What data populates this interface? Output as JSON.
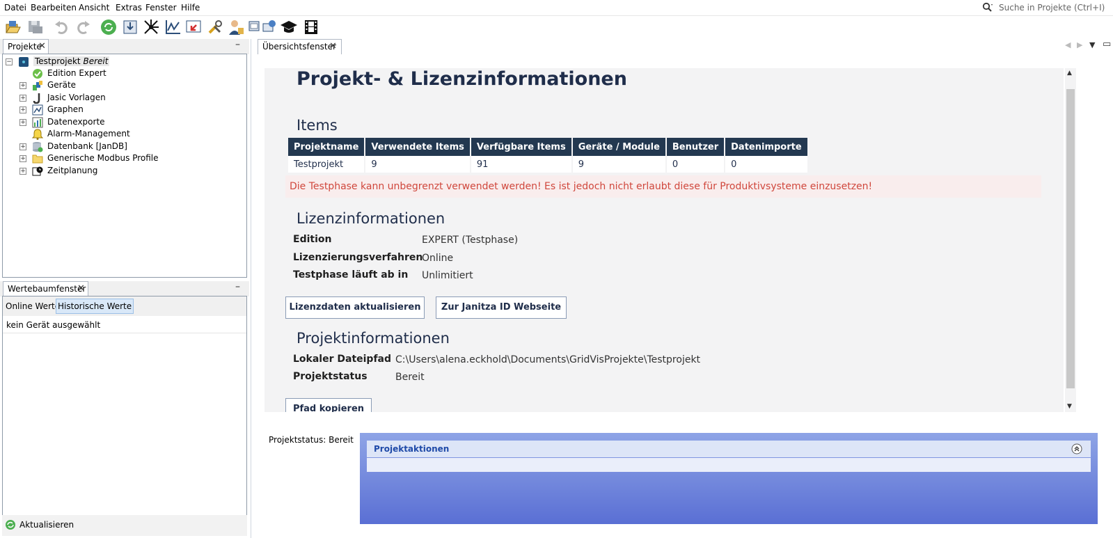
{
  "menu": [
    "Datei",
    "Bearbeiten",
    "Ansicht",
    "Extras",
    "Fenster",
    "Hilfe"
  ],
  "search": {
    "placeholder": "Suche in Projekte (Ctrl+I)"
  },
  "toolbar_icons": [
    "open-project-icon",
    "save-icon",
    "undo-icon",
    "redo-icon",
    "refresh-icon",
    "import-icon",
    "topology-icon",
    "graph-icon",
    "export-icon",
    "tools-icon",
    "user-icon",
    "device-window-icon",
    "academy-icon",
    "film-icon"
  ],
  "projects_panel": {
    "tab": "Projekte",
    "tree": [
      {
        "label": "Testprojekt",
        "status": "Bereit",
        "icon": "project-icon",
        "level": 0,
        "expandable": true
      },
      {
        "label": "Edition Expert",
        "icon": "check-circle-icon",
        "level": 1,
        "expandable": false
      },
      {
        "label": "Geräte",
        "icon": "devices-icon",
        "level": 1,
        "expandable": true
      },
      {
        "label": "Jasic Vorlagen",
        "icon": "jasic-icon",
        "level": 1,
        "expandable": true
      },
      {
        "label": "Graphen",
        "icon": "graph-icon",
        "level": 1,
        "expandable": true
      },
      {
        "label": "Datenexporte",
        "icon": "export-chart-icon",
        "level": 1,
        "expandable": true
      },
      {
        "label": "Alarm-Management",
        "icon": "bell-icon",
        "level": 1,
        "expandable": false
      },
      {
        "label": "Datenbank [JanDB]",
        "icon": "database-icon",
        "level": 1,
        "expandable": true
      },
      {
        "label": "Generische Modbus Profile",
        "icon": "folder-icon",
        "level": 1,
        "expandable": true
      },
      {
        "label": "Zeitplanung",
        "icon": "clock-icon",
        "level": 1,
        "expandable": true
      }
    ]
  },
  "value_tree_panel": {
    "tab": "Wertebaumfenster",
    "tabs": [
      "Online Werte",
      "Historische Werte"
    ],
    "selected_tab": "Historische Werte",
    "message": "kein Gerät ausgewählt",
    "refresh_label": "Aktualisieren"
  },
  "overview": {
    "tab": "Übersichtsfenster",
    "title": "Projekt- & Lizenzinformationen",
    "items_heading": "Items",
    "items_table": {
      "headers": [
        "Projektname",
        "Verwendete Items",
        "Verfügbare Items",
        "Geräte / Module",
        "Benutzer",
        "Datenimporte"
      ],
      "rows": [
        [
          "Testprojekt",
          "9",
          "91",
          "9",
          "0",
          "0"
        ]
      ]
    },
    "warning": "Die Testphase kann unbegrenzt verwendet werden! Es ist jedoch nicht erlaubt diese für Produktivsysteme einzusetzen!",
    "license_heading": "Lizenzinformationen",
    "license": [
      {
        "label": "Edition",
        "value": "EXPERT (Testphase)"
      },
      {
        "label": "Lizenzierungsverfahren",
        "value": "Online"
      },
      {
        "label": "Testphase läuft ab in",
        "value": "Unlimitiert"
      }
    ],
    "buttons": {
      "update_license": "Lizenzdaten aktualisieren",
      "janitza_id": "Zur Janitza ID Webseite",
      "copy_path": "Pfad kopieren"
    },
    "project_heading": "Projektinformationen",
    "project": [
      {
        "label": "Lokaler Dateipfad",
        "value": "C:\\Users\\alena.eckhold\\Documents\\GridVisProjekte\\Testprojekt"
      },
      {
        "label": "Projektstatus",
        "value": "Bereit"
      }
    ]
  },
  "status_bar": {
    "project_status": "Projektstatus: Bereit"
  },
  "project_actions": {
    "title": "Projektaktionen"
  },
  "colors": {
    "header_dark": "#233850",
    "warning_text": "#d0473c",
    "warning_bg": "#f9eded",
    "actions_gradient_top": "#8ea4e6",
    "actions_gradient_bottom": "#5a6fd4"
  }
}
